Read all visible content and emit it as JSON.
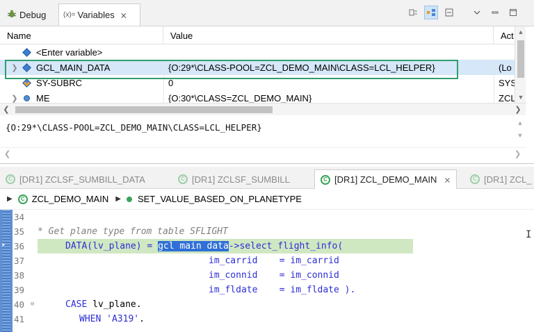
{
  "top_view": {
    "tabs": [
      {
        "label": "Debug",
        "icon": "bug-icon"
      },
      {
        "prefix": "(x)=",
        "label": "Variables",
        "close": "⨯"
      }
    ],
    "columns": {
      "name": "Name",
      "value": "Value",
      "act": "Act"
    },
    "rows": [
      {
        "name": "<Enter variable>",
        "value": "",
        "act": ""
      },
      {
        "name": "GCL_MAIN_DATA",
        "value": "{O:29*\\CLASS-POOL=ZCL_DEMO_MAIN\\CLASS=LCL_HELPER}",
        "act": "(Lo",
        "selected": true
      },
      {
        "name": "SY-SUBRC",
        "value": "0",
        "act": "SYS"
      },
      {
        "name": "ME",
        "value": "{O:30*\\CLASS=ZCL_DEMO_MAIN}",
        "act": "ZCL"
      }
    ],
    "detail_text": "{O:29*\\CLASS-POOL=ZCL_DEMO_MAIN\\CLASS=LCL_HELPER}",
    "highlight_color": "#2f9e6f"
  },
  "editor_tabs": [
    {
      "label": "[DR1] ZCLSF_SUMBILL_DATA",
      "active": false
    },
    {
      "label": "[DR1] ZCLSF_SUMBILL",
      "active": false
    },
    {
      "label": "[DR1] ZCL_DEMO_MAIN",
      "active": true
    },
    {
      "label": "[DR1] ZCL_",
      "active": false
    }
  ],
  "breadcrumb": {
    "class_name": "ZCL_DEMO_MAIN",
    "method_name": "SET_VALUE_BASED_ON_PLANETYPE"
  },
  "code": {
    "line_numbers": [
      "34",
      "35",
      "36",
      "37",
      "38",
      "39",
      "40",
      "41"
    ],
    "comment_35": "* Get plane type from table SFLIGHT",
    "l36_data": "DATA(lv_plane) = ",
    "l36_var": "gcl main data",
    "l36_rest": "->select_flight_info(",
    "l37": "im_carrid    = im_carrid",
    "l38": "im_connid    = im_connid",
    "l39a": "im_fldate    = im_fldate ",
    "l39b": ").",
    "l40_kw": "CASE",
    "l40_rest": " lv_plane.",
    "l41_kw": "WHEN",
    "l41_str": " 'A319'",
    "l41_end": "."
  },
  "colors": {
    "accent_green": "#3aa35a",
    "current_line": "#d0e8c2",
    "selection": "#2f6fd6"
  }
}
